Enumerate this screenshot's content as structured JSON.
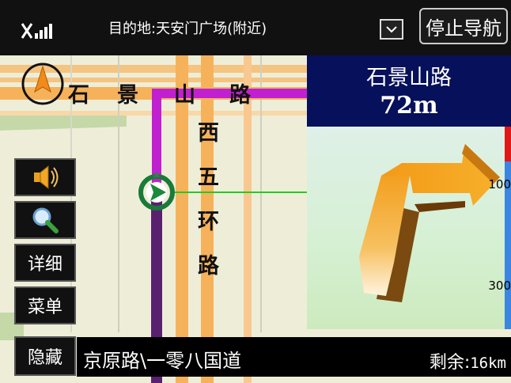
{
  "top_bar": {
    "destination_label": "目的地:天安门广场(附近)",
    "stop_navigation_label": "停止导航",
    "signal_icon": "gps-signal-icon",
    "dropdown_icon": "chevron-down-icon"
  },
  "map": {
    "compass_icon": "north-compass-icon",
    "horizontal_road_chars": [
      "石",
      "景",
      "山",
      "路"
    ],
    "vertical_road_chars": [
      "西",
      "五",
      "环",
      "路"
    ],
    "vehicle_icon": "vehicle-position-icon",
    "route_color": "#c020d0",
    "road_color": "#f6b25a"
  },
  "side_buttons": {
    "voice_icon": "speaker-icon",
    "zoom_icon": "magnifier-icon",
    "detail_label": "详细",
    "menu_label": "菜单",
    "hide_label": "隐藏"
  },
  "turn_panel": {
    "next_road": "石景山路",
    "distance": "72m",
    "turn_arrow_icon": "turn-right-arrow-icon",
    "scale_top": "100",
    "scale_bottom": "300"
  },
  "bottom_bar": {
    "current_road": "京原路\\一零八国道",
    "remaining_label": "剩余:",
    "remaining_value": "16km"
  }
}
